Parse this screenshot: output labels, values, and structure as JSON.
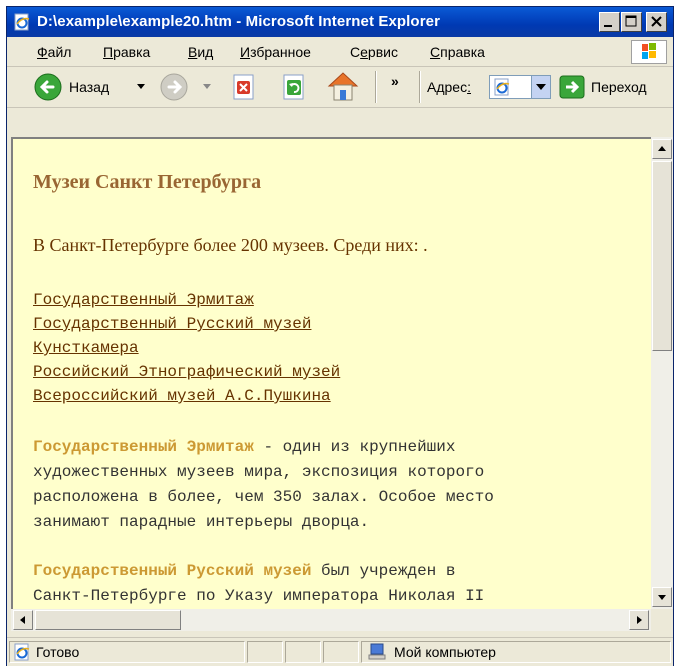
{
  "window": {
    "title": "D:\\example\\example20.htm - Microsoft Internet Explorer"
  },
  "menu": {
    "items": [
      {
        "prefix": "",
        "accel": "Ф",
        "rest": "айл"
      },
      {
        "prefix": "",
        "accel": "П",
        "rest": "равка"
      },
      {
        "prefix": "",
        "accel": "В",
        "rest": "ид"
      },
      {
        "prefix": "",
        "accel": "И",
        "rest": "збранное"
      },
      {
        "prefix": "С",
        "accel": "е",
        "rest": "рвис"
      },
      {
        "prefix": "",
        "accel": "С",
        "rest": "правка"
      }
    ]
  },
  "toolbar": {
    "back_label": "Назад",
    "chevron": "»",
    "address_label_pre": "Адрес",
    "address_label_accel": ":",
    "go_label": "Переход"
  },
  "page": {
    "heading": "Музеи Санкт Петербурга",
    "intro": "В Санкт-Петербурге более 200 музеев. Среди них: .",
    "links": [
      "Государственный Эрмитаж",
      "Государственный Русский музей",
      "Кунсткамера",
      "Российский Этнографический музей",
      "Всероссийский музей А.С.Пушкина"
    ],
    "para1": {
      "bold": "Государственный Эрмитаж",
      "text": " - один из крупнейших\nхудожественных музеев мира, экспозиция которого\nрасположена в более, чем 350 залах. Особое место\nзанимают парадные интерьеры дворца."
    },
    "para2": {
      "bold": "Государственный Русский музей",
      "text": " был учрежден в\nСанкт-Петербурге по Указу императора Николая II"
    }
  },
  "status": {
    "text": "Готово",
    "zone": "Мой компьютер"
  },
  "colors": {
    "page_background": "#ffffcc",
    "heading": "#996633",
    "link": "#663300",
    "bold_highlight": "#cc9933",
    "titlebar": "#0a5ad6"
  },
  "icons": [
    "ie-page-icon",
    "minimize-icon",
    "maximize-icon",
    "close-icon",
    "windows-logo-icon",
    "back-arrow-icon",
    "forward-arrow-icon",
    "stop-icon",
    "refresh-icon",
    "home-icon",
    "go-arrow-icon",
    "computer-icon"
  ]
}
